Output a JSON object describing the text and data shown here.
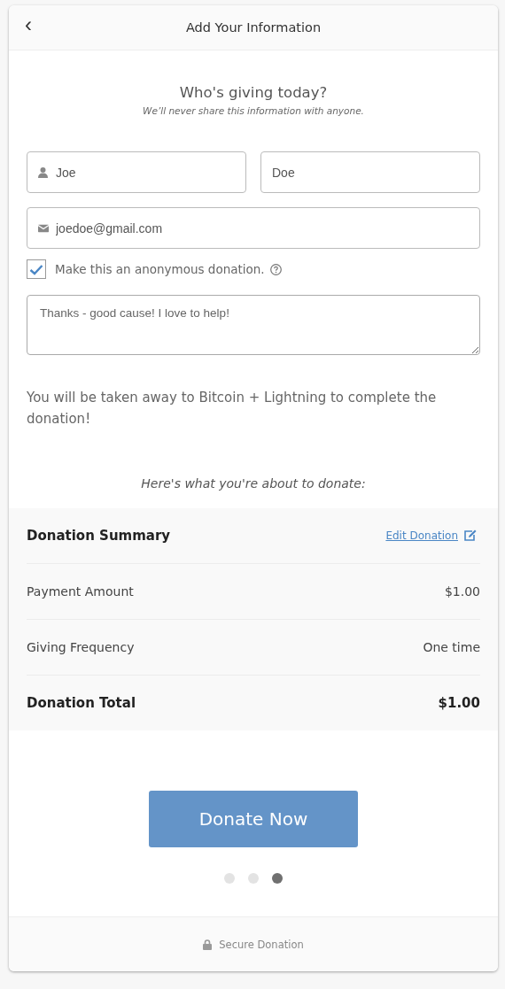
{
  "header": {
    "back": "‹",
    "title": "Add Your Information"
  },
  "intro": {
    "heading": "Who's giving today?",
    "subtitle": "We’ll never share this information with anyone."
  },
  "fields": {
    "first_name": {
      "value": "Joe"
    },
    "last_name": {
      "value": "Doe"
    },
    "email": {
      "value": "joedoe@gmail.com"
    },
    "message": {
      "value": "Thanks - good cause! I love to help!"
    }
  },
  "anonymous": {
    "label": "Make this an anonymous donation.",
    "checked": true
  },
  "notice": "You will be taken away to Bitcoin + Lightning to complete the donation!",
  "summary_intro": "Here's what you're about to donate:",
  "summary": {
    "title": "Donation Summary",
    "edit_link": "Edit Donation",
    "rows": [
      {
        "label": "Payment Amount",
        "value": "$1.00",
        "kind": "normal"
      },
      {
        "label": "Giving Frequency",
        "value": "One time",
        "kind": "normal"
      },
      {
        "label": "Donation Total",
        "value": "$1.00",
        "kind": "total"
      }
    ]
  },
  "donate_button": "Donate Now",
  "steps": [
    {
      "selected": false
    },
    {
      "selected": false
    },
    {
      "selected": true
    }
  ],
  "footer": "Secure Donation"
}
